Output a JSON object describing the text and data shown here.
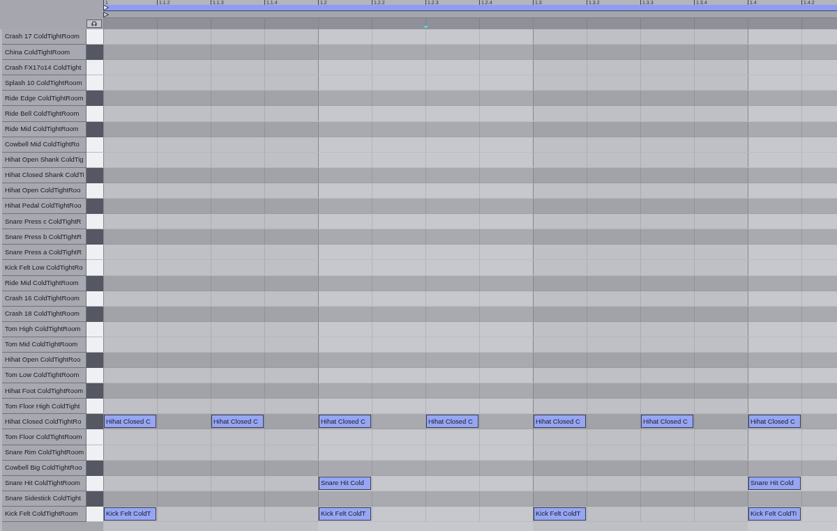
{
  "ruler": {
    "ticks": [
      {
        "label": "1",
        "insert_marker": false
      },
      {
        "label": "1.1.2",
        "insert_marker": false
      },
      {
        "label": "1.1.3",
        "insert_marker": false
      },
      {
        "label": "1.1.4",
        "insert_marker": false
      },
      {
        "label": "1.2",
        "insert_marker": false
      },
      {
        "label": "1.2.2",
        "insert_marker": false
      },
      {
        "label": "1.2.3",
        "insert_marker": true
      },
      {
        "label": "1.2.4",
        "insert_marker": false
      },
      {
        "label": "1.3",
        "insert_marker": false
      },
      {
        "label": "1.3.2",
        "insert_marker": false
      },
      {
        "label": "1.3.3",
        "insert_marker": false
      },
      {
        "label": "1.3.4",
        "insert_marker": false
      },
      {
        "label": "1.4",
        "insert_marker": false
      },
      {
        "label": "1.4.2",
        "insert_marker": false
      }
    ]
  },
  "rows": [
    {
      "label": "Crash 17 ColdTightRoom",
      "kind": "white"
    },
    {
      "label": "China ColdTightRoom",
      "kind": "black"
    },
    {
      "label": "Crash FX17o14 ColdTight",
      "kind": "white"
    },
    {
      "label": "Splash 10 ColdTightRoom",
      "kind": "white"
    },
    {
      "label": "Ride Edge ColdTightRoom",
      "kind": "black"
    },
    {
      "label": "Ride Bell ColdTightRoom",
      "kind": "white"
    },
    {
      "label": "Ride Mid ColdTightRoom",
      "kind": "black"
    },
    {
      "label": "Cowbell Mid ColdTightRo",
      "kind": "white"
    },
    {
      "label": "Hihat Open Shank ColdTig",
      "kind": "white"
    },
    {
      "label": "Hihat Closed Shank ColdTi",
      "kind": "black"
    },
    {
      "label": "Hihat Open ColdTightRoo",
      "kind": "white"
    },
    {
      "label": "Hihat Pedal ColdTightRoo",
      "kind": "black"
    },
    {
      "label": "Snare Press c ColdTightR",
      "kind": "white"
    },
    {
      "label": "Snare Press b ColdTightR",
      "kind": "black"
    },
    {
      "label": "Snare Press a ColdTightR",
      "kind": "white"
    },
    {
      "label": "Kick Felt Low ColdTightRo",
      "kind": "white"
    },
    {
      "label": "Ride Mid ColdTightRoom",
      "kind": "black"
    },
    {
      "label": "Crash 16 ColdTightRoom",
      "kind": "white"
    },
    {
      "label": "Crash 18 ColdTightRoom",
      "kind": "black"
    },
    {
      "label": "Tom High ColdTightRoom",
      "kind": "white"
    },
    {
      "label": "Tom Mid ColdTightRoom",
      "kind": "white"
    },
    {
      "label": "Hihat Open ColdTightRoo",
      "kind": "black"
    },
    {
      "label": "Tom Low ColdTightRoom",
      "kind": "white"
    },
    {
      "label": "Hihat Foot ColdTightRoom",
      "kind": "black"
    },
    {
      "label": "Tom Floor High ColdTight",
      "kind": "white"
    },
    {
      "label": "Hihat Closed ColdTightRo",
      "kind": "black",
      "steps": [
        {
          "on": true,
          "label": "Hihat Closed C"
        },
        {
          "on": false
        },
        {
          "on": true,
          "label": "Hihat Closed C"
        },
        {
          "on": false
        },
        {
          "on": true,
          "label": "Hihat Closed C"
        },
        {
          "on": false
        },
        {
          "on": true,
          "label": "Hihat Closed C"
        },
        {
          "on": false
        },
        {
          "on": true,
          "label": "Hihat Closed C"
        },
        {
          "on": false
        },
        {
          "on": true,
          "label": "Hihat Closed C"
        },
        {
          "on": false
        },
        {
          "on": true,
          "label": "Hihat Closed C"
        },
        {
          "on": false
        }
      ]
    },
    {
      "label": "Tom Floor ColdTightRoom",
      "kind": "white"
    },
    {
      "label": "Snare Rim ColdTightRoom",
      "kind": "white"
    },
    {
      "label": "Cowbell Big ColdTightRoo",
      "kind": "black"
    },
    {
      "label": "Snare Hit ColdTightRoom",
      "kind": "white",
      "steps": [
        {
          "on": false
        },
        {
          "on": false
        },
        {
          "on": false
        },
        {
          "on": false
        },
        {
          "on": true,
          "label": "Snare Hit Cold"
        },
        {
          "on": false
        },
        {
          "on": false
        },
        {
          "on": false
        },
        {
          "on": false
        },
        {
          "on": false
        },
        {
          "on": false
        },
        {
          "on": false
        },
        {
          "on": true,
          "label": "Snare Hit Cold"
        },
        {
          "on": false
        }
      ]
    },
    {
      "label": "Snare Sidestick ColdTight",
      "kind": "black"
    },
    {
      "label": "Kick Felt ColdTightRoom",
      "kind": "white",
      "steps": [
        {
          "on": true,
          "label": "Kick Felt ColdT"
        },
        {
          "on": false
        },
        {
          "on": false
        },
        {
          "on": false
        },
        {
          "on": true,
          "label": "Kick Felt ColdT"
        },
        {
          "on": false
        },
        {
          "on": false
        },
        {
          "on": false
        },
        {
          "on": true,
          "label": "Kick Felt ColdT"
        },
        {
          "on": false
        },
        {
          "on": false
        },
        {
          "on": false
        },
        {
          "on": true,
          "label": "Kick Felt ColdTi"
        },
        {
          "on": false
        }
      ]
    }
  ]
}
